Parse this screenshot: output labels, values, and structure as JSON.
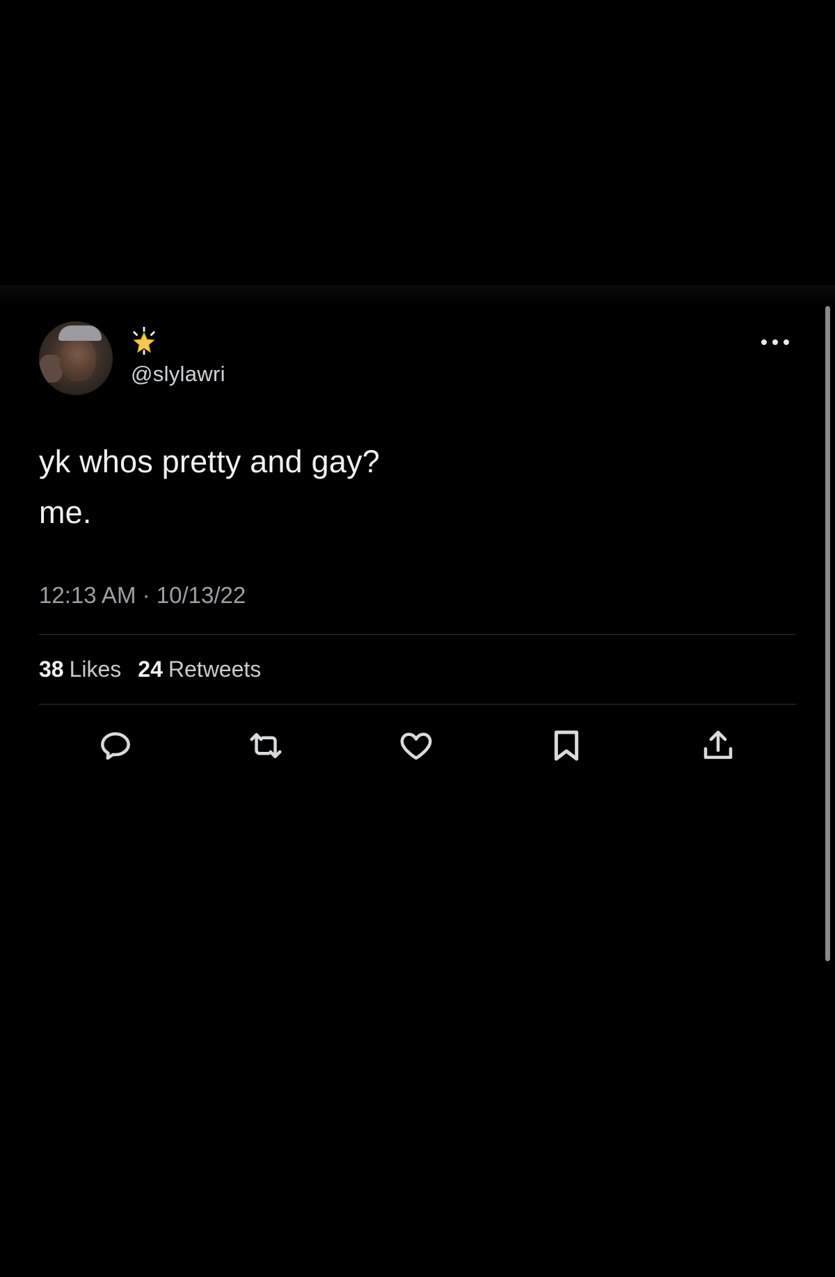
{
  "tweet": {
    "handle": "@slylawri",
    "text": "yk whos pretty and gay?\nme.",
    "timestamp": "12:13 AM · 10/13/22",
    "likes_count": "38",
    "likes_label": "Likes",
    "retweets_count": "24",
    "retweets_label": "Retweets"
  },
  "icons": {
    "name_emoji": "glowing-star-icon",
    "more": "more-options-icon",
    "actions": [
      "reply-icon",
      "retweet-icon",
      "like-icon",
      "bookmark-icon",
      "share-icon"
    ]
  },
  "colors": {
    "background": "#000000",
    "text": "#f2f2f2",
    "secondary_text": "#9aa0a6",
    "divider": "#2f3336",
    "star": "#f7c948"
  }
}
